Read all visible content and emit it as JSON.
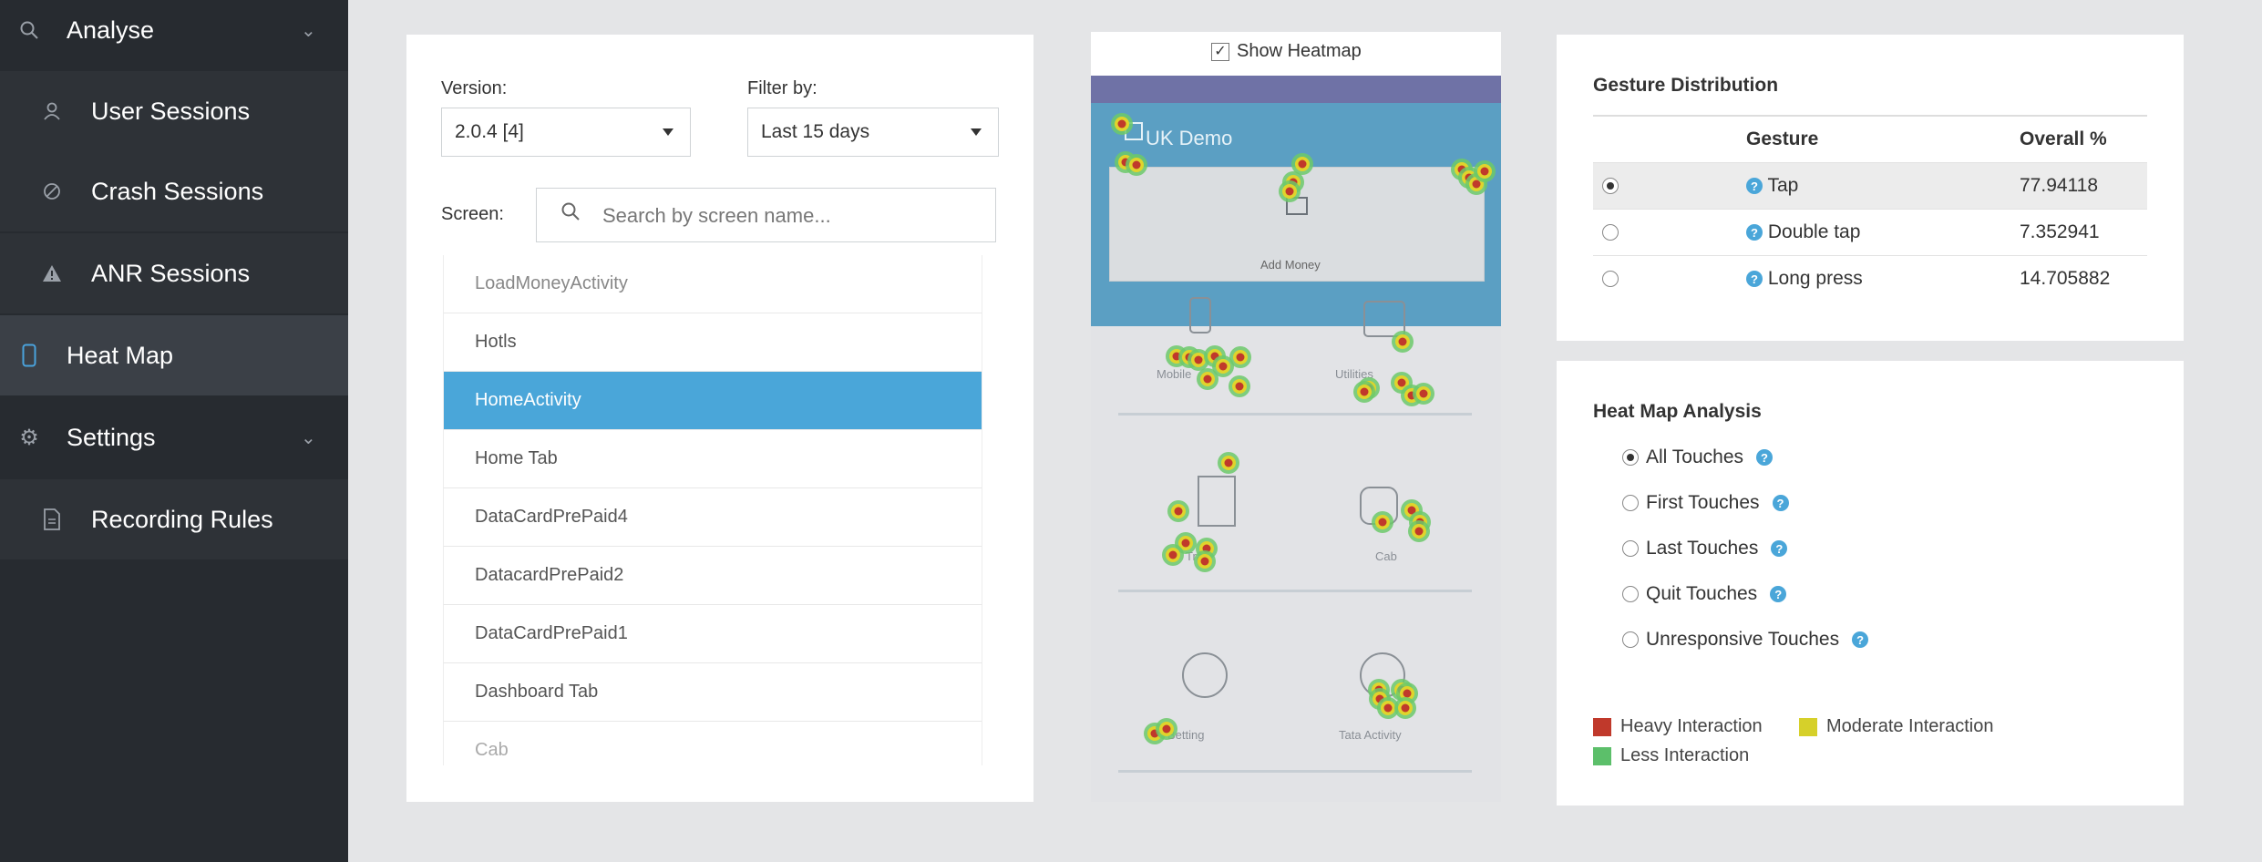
{
  "sidebar": {
    "items": [
      {
        "label": "Analyse",
        "icon": "search-icon"
      },
      {
        "label": "User Sessions",
        "icon": "user-icon"
      },
      {
        "label": "Crash Sessions",
        "icon": "ban-icon"
      },
      {
        "label": "ANR Sessions",
        "icon": "warning-icon"
      },
      {
        "label": "Heat Map",
        "icon": "phone-icon"
      },
      {
        "label": "Settings",
        "icon": "gear-icon"
      },
      {
        "label": "Recording Rules",
        "icon": "document-icon"
      }
    ]
  },
  "filters": {
    "version_label": "Version:",
    "version_value": "2.0.4 [4]",
    "filter_label": "Filter by:",
    "filter_value": "Last 15 days",
    "screen_label": "Screen:",
    "search_placeholder": "Search by screen name..."
  },
  "screens": [
    "LoadMoneyActivity",
    "Hotls",
    "HomeActivity",
    "Home Tab",
    "DataCardPrePaid4",
    "DatacardPrePaid2",
    "DataCardPrePaid1",
    "Dashboard Tab",
    "Cab"
  ],
  "selected_screen": "HomeActivity",
  "phone": {
    "show_heatmap_label": "Show Heatmap",
    "app_title": "UK Demo",
    "add_money_label": "Add Money",
    "ghost_labels": [
      "Mobile",
      "Utilities",
      "Train",
      "Cab",
      "Betting",
      "Tata Activity"
    ]
  },
  "gesture": {
    "title": "Gesture Distribution",
    "col_gesture": "Gesture",
    "col_overall": "Overall %",
    "rows": [
      {
        "gesture": "Tap",
        "overall": "77.94118",
        "selected": true
      },
      {
        "gesture": "Double tap",
        "overall": "7.352941",
        "selected": false
      },
      {
        "gesture": "Long press",
        "overall": "14.705882",
        "selected": false
      }
    ]
  },
  "heatmap_analysis": {
    "title": "Heat Map Analysis",
    "options": [
      {
        "label": "All Touches",
        "selected": true
      },
      {
        "label": "First Touches",
        "selected": false
      },
      {
        "label": "Last Touches",
        "selected": false
      },
      {
        "label": "Quit Touches",
        "selected": false
      },
      {
        "label": "Unresponsive Touches",
        "selected": false
      }
    ],
    "legend": [
      {
        "label": "Heavy Interaction",
        "color": "#c0392b"
      },
      {
        "label": "Moderate Interaction",
        "color": "#d6d02a"
      },
      {
        "label": "Less Interaction",
        "color": "#5cbf6a"
      }
    ]
  }
}
